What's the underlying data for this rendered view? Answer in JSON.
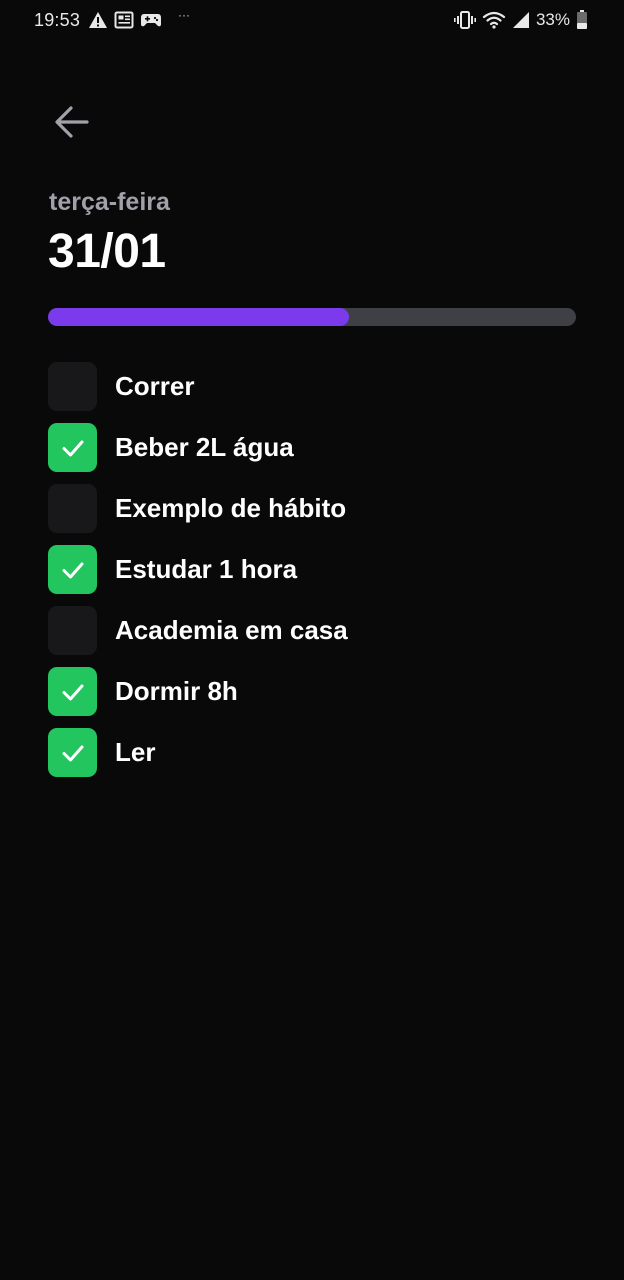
{
  "status_bar": {
    "time": "19:53",
    "notification_icons": [
      "warning-icon",
      "news-icon",
      "game-controller-icon"
    ],
    "overflow": "···",
    "battery_percent": "33%"
  },
  "header": {
    "back_icon": "arrow-left-icon",
    "weekday": "terça-feira",
    "date": "31/01"
  },
  "progress": {
    "completed_fraction": 0.57,
    "fill_color": "#7c3aed",
    "track_color": "#3f3f46"
  },
  "habits": [
    {
      "label": "Correr",
      "checked": false
    },
    {
      "label": "Beber 2L água",
      "checked": true
    },
    {
      "label": "Exemplo de hábito",
      "checked": false
    },
    {
      "label": "Estudar 1 hora",
      "checked": true
    },
    {
      "label": "Academia em casa",
      "checked": false
    },
    {
      "label": "Dormir 8h",
      "checked": true
    },
    {
      "label": "Ler",
      "checked": true
    }
  ],
  "colors": {
    "background": "#09090a",
    "checked": "#22c55e",
    "unchecked": "#18181b"
  }
}
